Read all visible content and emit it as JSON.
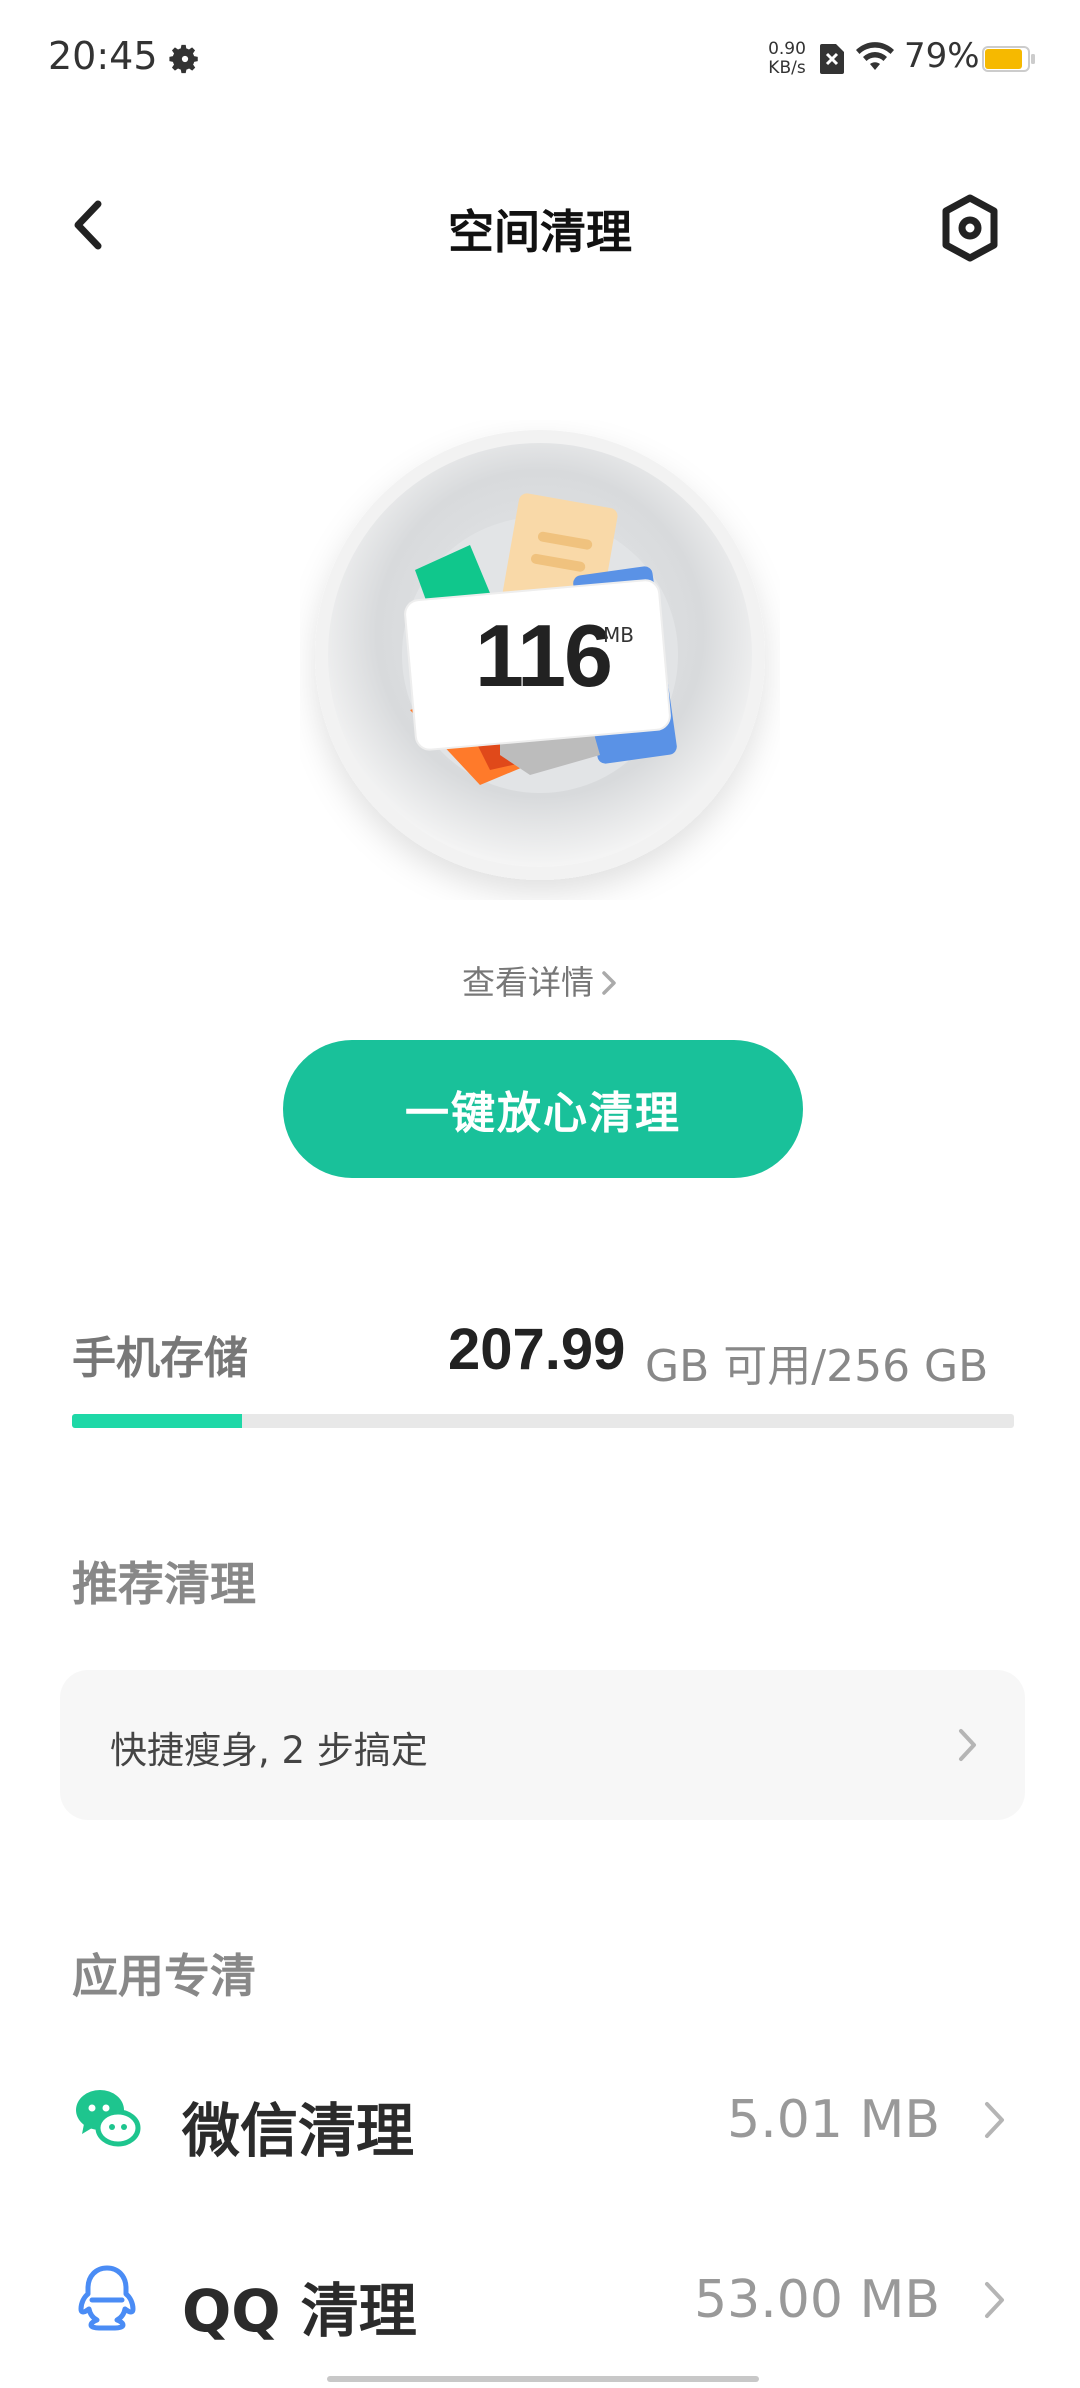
{
  "status_bar": {
    "time": "20:45",
    "net_speed_value": "0.90",
    "net_speed_unit": "KB/s",
    "battery": "79%",
    "battery_level": 0.79,
    "battery_color": "#f6b900",
    "icons": [
      "gear-icon",
      "no-sim-icon",
      "wifi-icon",
      "battery-icon"
    ]
  },
  "header": {
    "title": "空间清理",
    "back_icon": "chevron-left-icon",
    "settings_icon": "settings-icon"
  },
  "hero": {
    "junk_size": "116",
    "junk_unit": "MB",
    "details_link": "查看详情",
    "clean_button": "一键放心清理",
    "accent_color": "#19c19a"
  },
  "storage": {
    "label": "手机存储",
    "free_value": "207.99",
    "rest_text": "GB 可用/256 GB",
    "used_fraction": 0.18,
    "bar_color": "#1ed8a7"
  },
  "recommend": {
    "title": "推荐清理",
    "card_text": "快捷瘦身, 2 步搞定"
  },
  "apps": {
    "title": "应用专清",
    "items": [
      {
        "name": "微信清理",
        "size": "5.01 MB",
        "icon": "wechat-icon",
        "color": "#1ec58e"
      },
      {
        "name": "QQ 清理",
        "size": "53.00 MB",
        "icon": "qq-icon",
        "color": "#4a8cf5"
      }
    ]
  }
}
